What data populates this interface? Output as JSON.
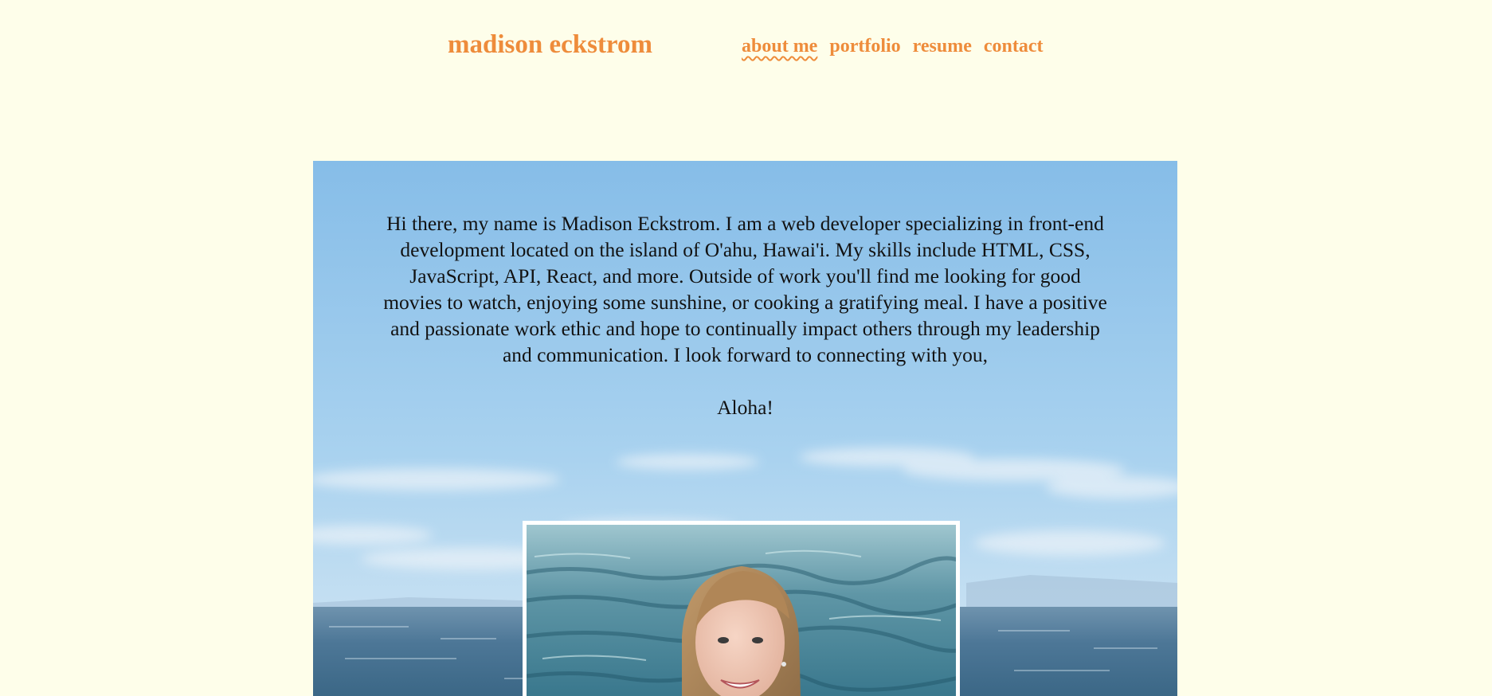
{
  "header": {
    "brand": "madison eckstrom",
    "nav": [
      {
        "label": "about me",
        "active": true
      },
      {
        "label": "portfolio",
        "active": false
      },
      {
        "label": "resume",
        "active": false
      },
      {
        "label": "contact",
        "active": false
      }
    ]
  },
  "hero": {
    "bio": "Hi there, my name is Madison Eckstrom. I am a web developer specializing in front-end development located on the island of O'ahu, Hawai'i. My skills include HTML, CSS, JavaScript, API, React, and more. Outside of work you'll find me looking for good movies to watch, enjoying some sunshine, or cooking a gratifying meal. I have a positive and passionate work ethic and hope to continually impact others through my leadership and communication. I look forward to connecting with you,",
    "greeting": "Aloha!"
  },
  "colors": {
    "page_bg": "#fefeea",
    "accent": "#ee8c3b",
    "text": "#121212",
    "sky_top": "#86bde8",
    "ocean": "#3f6f91"
  },
  "images": {
    "hero_background": "ocean-horizon-photo",
    "portrait": "profile-photo"
  }
}
